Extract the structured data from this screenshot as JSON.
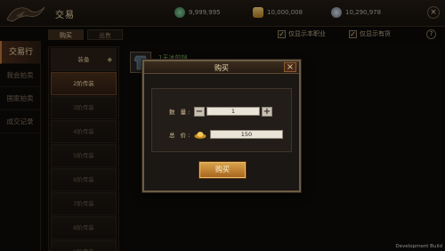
{
  "header": {
    "title": "交易",
    "currencies": [
      {
        "icon": "jade-coin-icon",
        "value": "9,999,995"
      },
      {
        "icon": "gold-ingot-icon",
        "value": "10,000,008"
      },
      {
        "icon": "silver-coin-icon",
        "value": "10,290,978"
      }
    ]
  },
  "left_menu": [
    {
      "label": "交易行",
      "active": true
    },
    {
      "label": "我会拍卖",
      "active": false
    },
    {
      "label": "国家拍卖",
      "active": false
    },
    {
      "label": "成交记录",
      "active": false
    }
  ],
  "tabs": [
    {
      "label": "购买",
      "active": true
    },
    {
      "label": "出售",
      "active": false
    }
  ],
  "filters": [
    {
      "label": "仅显示本职业",
      "checked": true
    },
    {
      "label": "仅显示有货",
      "checked": true
    }
  ],
  "categories": {
    "header": "装备",
    "items": [
      "2阶传装",
      "3阶传装",
      "4阶传装",
      "5阶传装",
      "6阶传装",
      "7阶传装",
      "8阶传装",
      "9阶传装"
    ]
  },
  "listing": {
    "item_name": "1天冰的铠"
  },
  "dialog": {
    "title": "购买",
    "close_label": "×",
    "quantity_label": "数 量:",
    "quantity_value": "1",
    "minus_label": "−",
    "plus_label": "+",
    "price_label": "总 价:",
    "price_value": "150",
    "buy_button": "购买"
  },
  "footer": {
    "dev_build": "Development Build"
  }
}
